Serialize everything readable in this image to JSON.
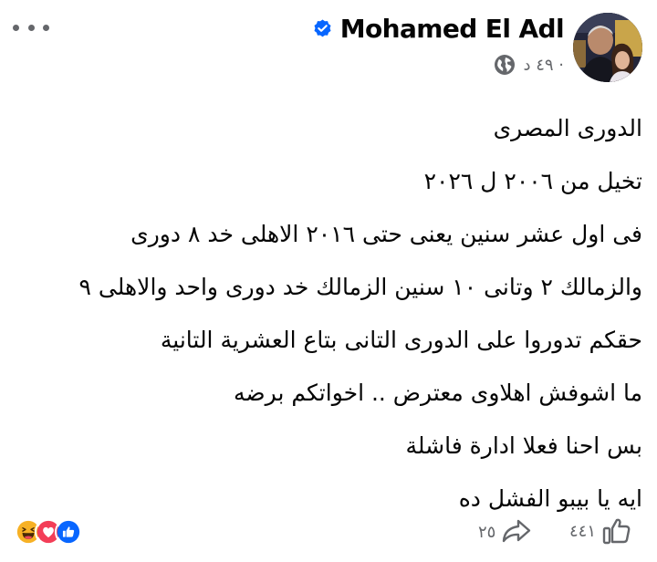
{
  "post": {
    "author": "Mohamed El Adl",
    "time": "٤٩ د ·",
    "lines": [
      "الدورى المصرى",
      "تخيل من ٢٠٠٦ ل ٢٠٢٦",
      "فى اول عشر سنين يعنى حتى ٢٠١٦ الاهلى خد ٨ دورى",
      "والزمالك ٢ وتانى ١٠ سنين الزمالك خد دورى واحد والاهلى ٩",
      "حقكم تدوروا على الدورى التانى بتاع العشرية التانية",
      "ما اشوفش اهلاوى معترض .. اخواتكم برضه",
      "بس احنا فعلا ادارة فاشلة",
      "ايه يا بيبو الفشل ده"
    ]
  },
  "engagement": {
    "like_count": "٤٤١",
    "share_count": "٢٥",
    "reactions": [
      "like-icon",
      "love-icon",
      "haha-icon"
    ]
  },
  "colors": {
    "text": "#050505",
    "secondary": "#65676b",
    "verified": "#0866ff",
    "like": "#0866ff",
    "love": "#f33e58",
    "haha": "#f7b125"
  }
}
